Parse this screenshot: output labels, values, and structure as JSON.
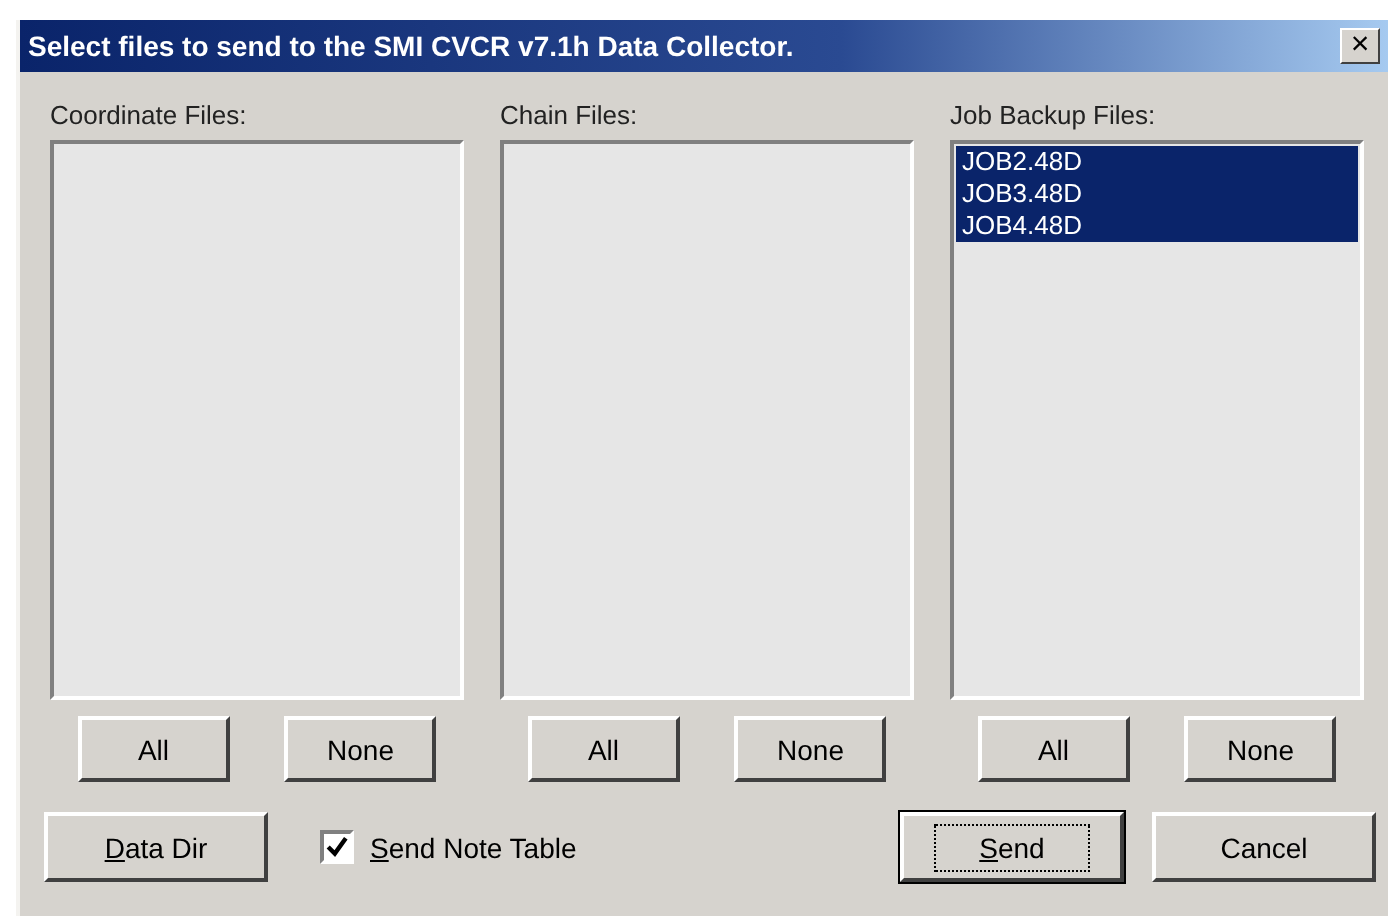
{
  "window": {
    "title": "Select files to send to the SMI CVCR v7.1h Data Collector.",
    "close": "×"
  },
  "lists": [
    {
      "label": "Coordinate Files:",
      "buttons": [
        "All",
        "None"
      ]
    },
    {
      "label": "Chain Files:",
      "buttons": [
        "All",
        "None"
      ]
    },
    {
      "label": "Job Backup Files:",
      "items": [
        {
          "text": "JOB2.48D",
          "selected": true
        },
        {
          "text": "JOB3.48D",
          "selected": true
        },
        {
          "text": "JOB4.48D",
          "selected": true
        }
      ],
      "buttons": [
        "All",
        "None"
      ]
    }
  ],
  "data_dir_button": {
    "label": "Data Dir"
  },
  "send_note_table": {
    "label": "Send Note Table",
    "checked": true
  },
  "send_button": {
    "label": "Send",
    "default": true
  },
  "cancel_button": {
    "label": "Cancel"
  }
}
